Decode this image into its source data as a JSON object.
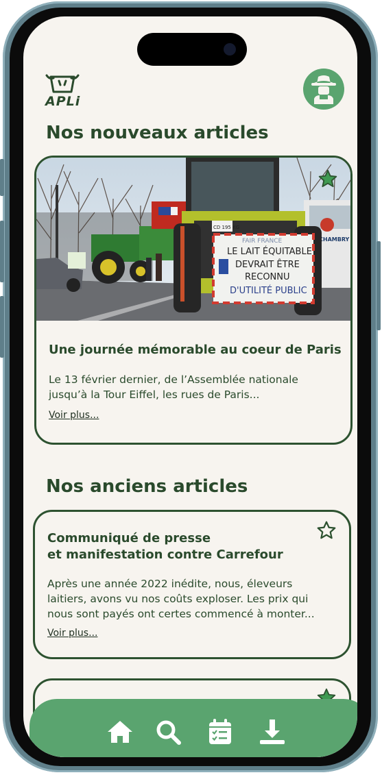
{
  "app": {
    "logo_text": "APLi"
  },
  "sections": {
    "new_title": "Nos nouveaux articles",
    "old_title": "Nos anciens articles"
  },
  "featured": {
    "title": "Une journée mémorable au coeur de Paris",
    "excerpt_line1": "Le 13 février dernier, de l’Assemblée nationale",
    "excerpt_line2": "jusqu’à la Tour Eiffel, les rues de Paris...",
    "more": "Voir plus...",
    "favorited": true,
    "sign_line0": "FAIR FRANCE",
    "sign_line1": "LE LAIT ÉQUITABLE",
    "sign_line2": "DEVRAIT ÊTRE",
    "sign_line3": "RECONNU",
    "sign_line4": "D'UTILITÉ PUBLIC",
    "plate": "CD 195 KG",
    "truck_text": "CHAMBRY"
  },
  "articles": [
    {
      "title_line1": "Communiqué de presse",
      "title_line2": "et manifestation contre Carrefour",
      "excerpt_line1": "Après une année 2022 inédite, nous, éleveurs",
      "excerpt_line2": "laitiers, avons vu nos coûts exploser. Les prix qui",
      "excerpt_line3": "nous sont payés ont certes commencé à monter...",
      "more": "Voir plus...",
      "favorited": false
    },
    {
      "favorited": true
    }
  ],
  "nav": [
    "home-icon",
    "search-icon",
    "calendar-check-icon",
    "download-icon"
  ],
  "colors": {
    "primary": "#5aa46f",
    "dark_green": "#2a4a2c",
    "background": "#f7f4ef"
  }
}
